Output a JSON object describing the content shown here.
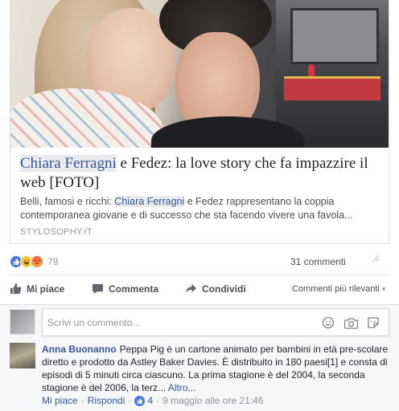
{
  "link_card": {
    "title_highlight": "Chiara Ferragni",
    "title_rest": " e Fedez: la love story che fa impazzire il web [FOTO]",
    "desc_prefix": "Belli, famosi e ricchi: ",
    "desc_highlight": "Chiara Ferragni",
    "desc_rest": " e Fedez rappresentano la coppia contemporanea giovane e di successo che sta facendo vivere una favola",
    "desc_ellipsis": "...",
    "source": "STYLOSOPHY.IT"
  },
  "reactions": {
    "count": "79",
    "types": [
      "like-icon",
      "haha-icon",
      "angry-icon"
    ],
    "comments_count": "31 commenti"
  },
  "actions": {
    "like": "Mi piace",
    "comment": "Commenta",
    "share": "Condividi",
    "sort": "Commenti più rilevanti"
  },
  "composer": {
    "placeholder": "Scrivi un commento..."
  },
  "comment": {
    "author": "Anna Buonanno",
    "text": "Peppa Pig è un cartone animato per bambini in età pre-scolare diretto e prodotto da Astley Baker Davies. È distribuito in 180 paesi[1] e consta di episodi di 5 minuti circa ciascuno. La prima stagione è del 2004, la seconda stagione è del 2006, la terz...",
    "more": "Altro...",
    "like_link": "Mi piace",
    "reply_link": "Rispondi",
    "like_count": "4",
    "timestamp": "9 maggio alle ore 21:46"
  },
  "colors": {
    "link_blue": "#365899",
    "like_blue": "#4a76e0",
    "muted": "#90949c",
    "text": "#1d2129"
  }
}
